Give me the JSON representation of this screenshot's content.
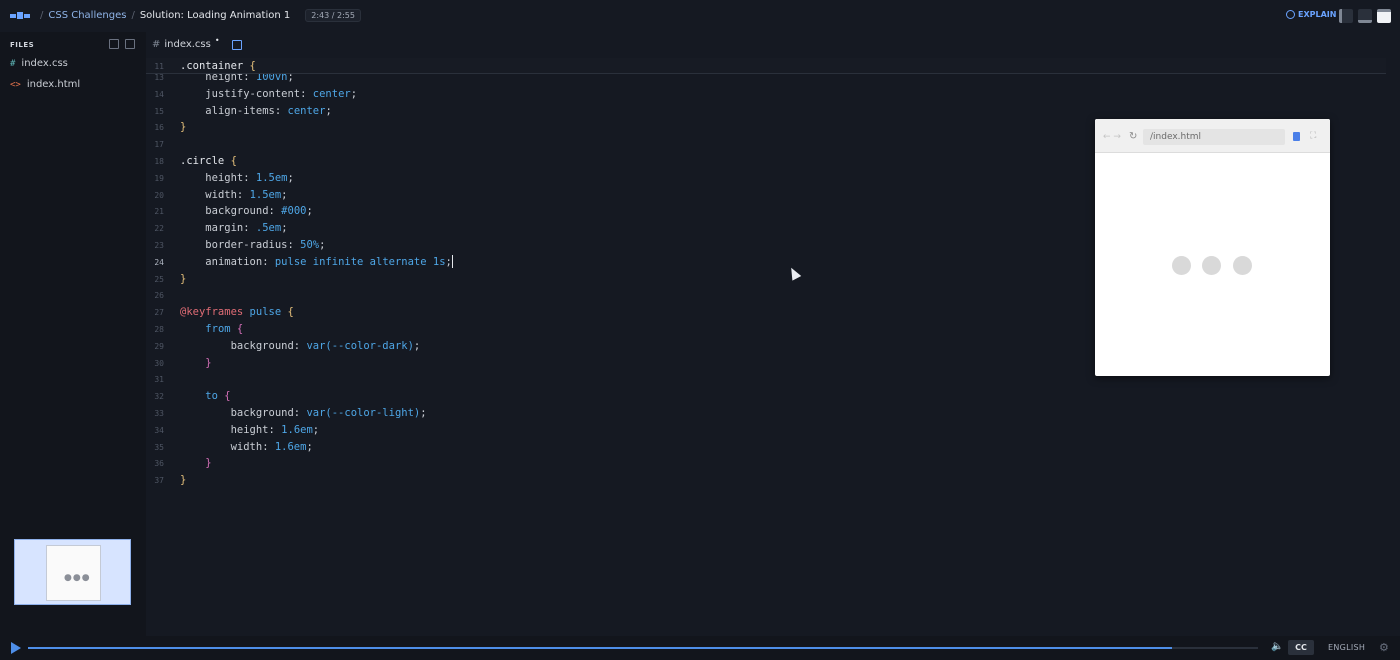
{
  "topbar": {
    "crumbs": [
      "CSS Challenges",
      "Solution: Loading Animation 1"
    ],
    "time": "2:43 / 2:55",
    "explain_label": "EXPLAIN"
  },
  "sidebar": {
    "files_label": "FILES",
    "files": [
      {
        "icon": "#",
        "name": "index.css",
        "icon_color": "#5fb8b8"
      },
      {
        "icon": "<>",
        "name": "index.html",
        "icon_color": "#e5734d"
      }
    ]
  },
  "editor": {
    "tab": {
      "icon": "#",
      "name": "index.css",
      "modified": "•"
    },
    "lines": [
      {
        "n": "11",
        "text": ".container {"
      },
      {
        "n": "13",
        "text": "    height: 100vh;"
      },
      {
        "n": "14",
        "text": "    justify-content: center;"
      },
      {
        "n": "15",
        "text": "    align-items: center;"
      },
      {
        "n": "16",
        "text": "}"
      },
      {
        "n": "17",
        "text": ""
      },
      {
        "n": "18",
        "text": ".circle {"
      },
      {
        "n": "19",
        "text": "    height: 1.5em;"
      },
      {
        "n": "20",
        "text": "    width: 1.5em;"
      },
      {
        "n": "21",
        "text": "    background: #000;"
      },
      {
        "n": "22",
        "text": "    margin: .5em;"
      },
      {
        "n": "23",
        "text": "    border-radius: 50%;"
      },
      {
        "n": "24",
        "text": "    animation: pulse infinite alternate 1s;"
      },
      {
        "n": "25",
        "text": "}"
      },
      {
        "n": "26",
        "text": ""
      },
      {
        "n": "27",
        "text": "@keyframes pulse {"
      },
      {
        "n": "28",
        "text": "    from {"
      },
      {
        "n": "29",
        "text": "        background: var(--color-dark);"
      },
      {
        "n": "30",
        "text": "    }"
      },
      {
        "n": "31",
        "text": ""
      },
      {
        "n": "32",
        "text": "    to {"
      },
      {
        "n": "33",
        "text": "        background: var(--color-light);"
      },
      {
        "n": "34",
        "text": "        height: 1.6em;"
      },
      {
        "n": "35",
        "text": "        width: 1.6em;"
      },
      {
        "n": "36",
        "text": "    }"
      },
      {
        "n": "37",
        "text": "}"
      }
    ]
  },
  "preview": {
    "url": "/index.html",
    "dots": 3
  },
  "player": {
    "progress": 0.93,
    "cc_label": "CC",
    "language": "ENGLISH"
  },
  "colors": {
    "accent": "#4e8ee8",
    "value": "#4ea6e6",
    "brace": "#e5c07b",
    "at_rule": "#e06c75"
  }
}
